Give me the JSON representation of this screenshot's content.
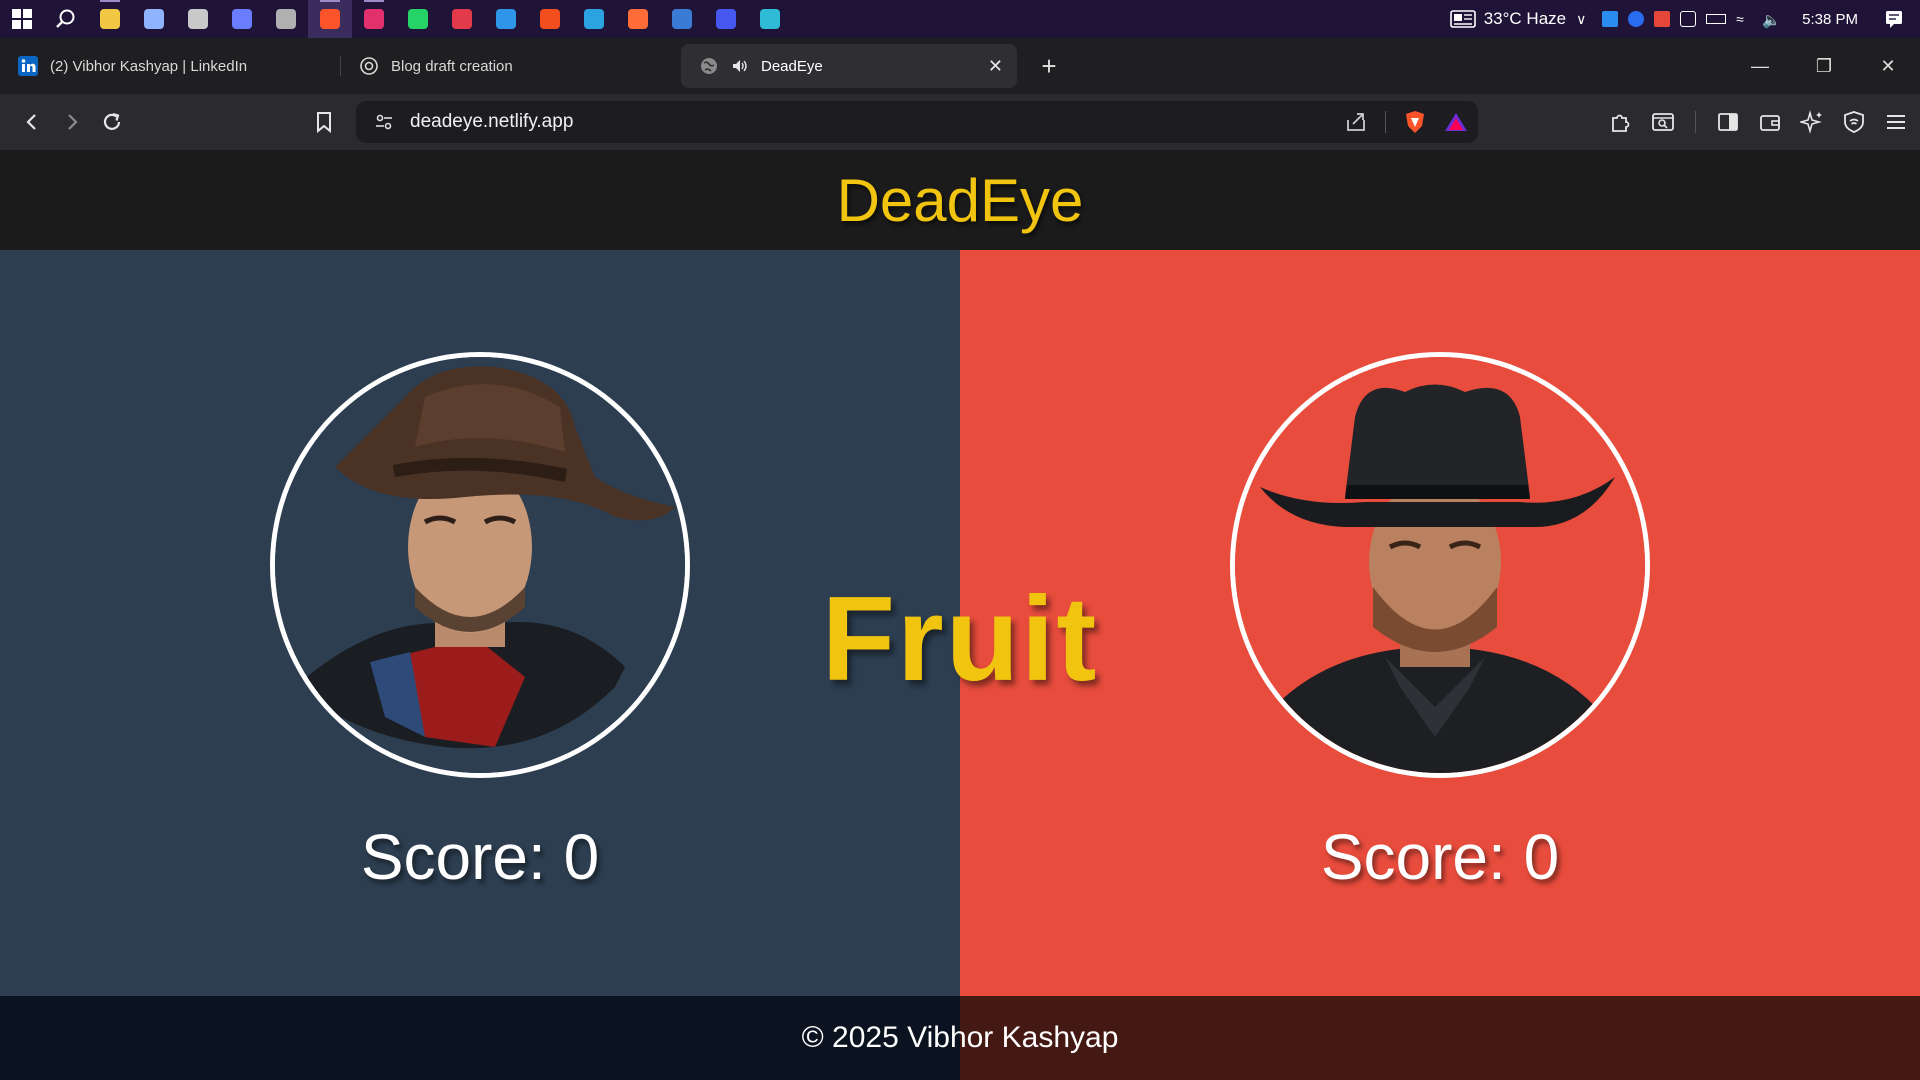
{
  "taskbar": {
    "weather": "33°C  Haze",
    "time": "5:38 PM",
    "apps": [
      {
        "name": "file-explorer-icon",
        "color": "#f2c744",
        "running": true
      },
      {
        "name": "app-icon-1",
        "color": "#8fb4ff",
        "running": false
      },
      {
        "name": "app-icon-2",
        "color": "#c9c9c9",
        "running": false
      },
      {
        "name": "app-icon-3",
        "color": "#6a7cff",
        "running": false
      },
      {
        "name": "app-icon-4",
        "color": "#b0b0b0",
        "running": false
      },
      {
        "name": "brave-icon",
        "color": "#fb542b",
        "running": true
      },
      {
        "name": "instagram-icon",
        "color": "#e1306c",
        "running": true
      },
      {
        "name": "whatsapp-icon",
        "color": "#25d366",
        "running": false
      },
      {
        "name": "app-icon-5",
        "color": "#e23a4b",
        "running": false
      },
      {
        "name": "vscode-icon",
        "color": "#2f95e8",
        "running": false
      },
      {
        "name": "figma-icon",
        "color": "#f24e1e",
        "running": false
      },
      {
        "name": "telegram-icon",
        "color": "#2aa3e0",
        "running": false
      },
      {
        "name": "postman-icon",
        "color": "#ff6c37",
        "running": false
      },
      {
        "name": "app-icon-6",
        "color": "#3a7bd5",
        "running": false
      },
      {
        "name": "intellij-icon",
        "color": "#4658f0",
        "running": false
      },
      {
        "name": "edge-icon",
        "color": "#2fbad6",
        "running": false
      }
    ]
  },
  "tabs": [
    {
      "title": "(2) Vibhor Kashyap | LinkedIn",
      "icon": "linkedin-icon"
    },
    {
      "title": "Blog draft creation",
      "icon": "chatgpt-icon"
    },
    {
      "title": "DeadEye",
      "icon": "globe-icon",
      "active": true,
      "audio": true
    }
  ],
  "address": {
    "url": "deadeye.netlify.app"
  },
  "site": {
    "title": "DeadEye",
    "word": "Fruit",
    "players": [
      {
        "score_label": "Score: 0"
      },
      {
        "score_label": "Score: 0"
      }
    ],
    "footer": "© 2025 Vibhor Kashyap"
  },
  "colors": {
    "accent": "#f1c40f",
    "left_panel": "#2c3e50",
    "right_panel": "#e74c3c",
    "header": "#1b1b1b"
  }
}
